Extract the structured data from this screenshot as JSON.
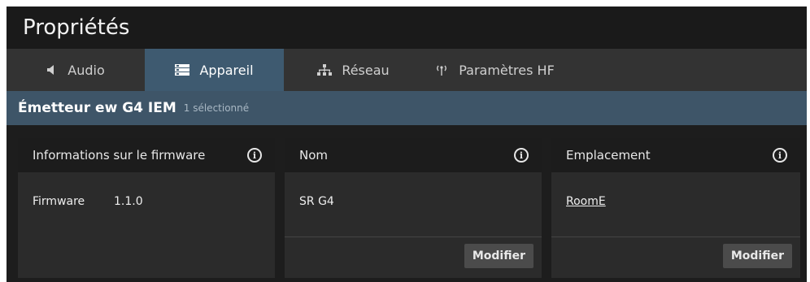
{
  "window": {
    "title": "Propriétés"
  },
  "tabs": [
    {
      "label": "Audio",
      "icon": "speaker-icon"
    },
    {
      "label": "Appareil",
      "icon": "device-icon",
      "active": true
    },
    {
      "label": "Réseau",
      "icon": "network-icon"
    },
    {
      "label": "Paramètres HF",
      "icon": "antenna-icon"
    }
  ],
  "subheader": {
    "device": "Émetteur ew G4 IEM",
    "selection": "1 sélectionné"
  },
  "cards": {
    "firmware": {
      "title": "Informations sur le firmware",
      "label": "Firmware",
      "value": "1.1.0"
    },
    "name": {
      "title": "Nom",
      "value": "SR G4",
      "button": "Modifier"
    },
    "location": {
      "title": "Emplacement",
      "value": "RoomE",
      "button": "Modifier"
    }
  },
  "colors": {
    "active_tab": "#3e5a70",
    "subheader": "#3e5568",
    "background": "#1d1d1d",
    "card": "#2b2b2b"
  }
}
